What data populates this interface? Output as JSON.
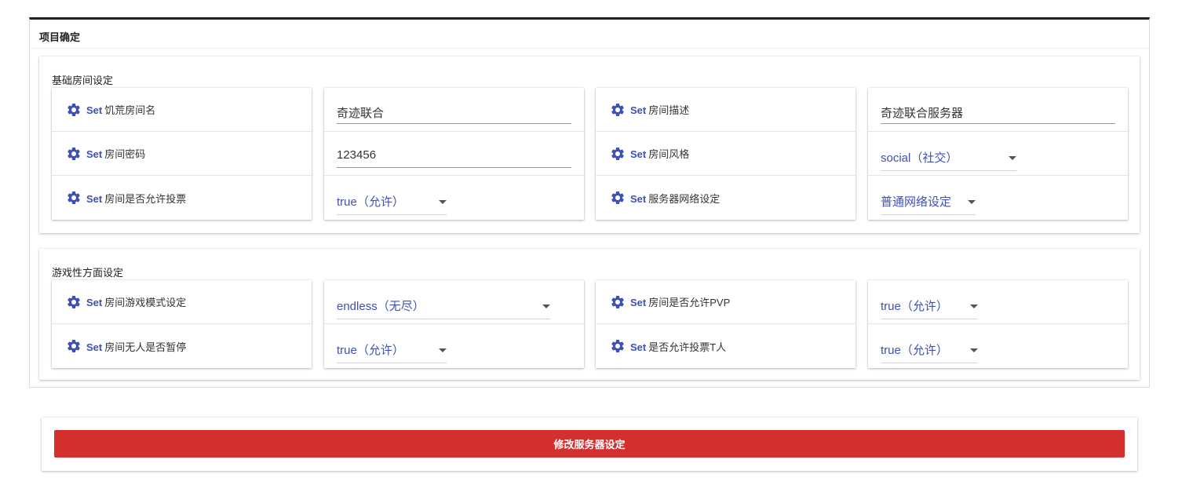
{
  "panel": {
    "title": "项目确定"
  },
  "basic": {
    "title": "基础房间设定",
    "set_prefix": "Set",
    "rows": [
      {
        "left_label": "饥荒房间名",
        "left_value": "奇迹联合",
        "right_label": "房间描述",
        "right_value": "奇迹联合服务器"
      },
      {
        "left_label": "房间密码",
        "left_value": "123456",
        "right_label": "房间风格",
        "right_value": "social（社交）"
      },
      {
        "left_label": "房间是否允许投票",
        "left_value": "true（允许）",
        "right_label": "服务器网络设定",
        "right_value": "普通网络设定"
      }
    ]
  },
  "game": {
    "title": "游戏性方面设定",
    "set_prefix": "Set",
    "rows": [
      {
        "left_label": "房间游戏模式设定",
        "left_value": "endless（无尽）",
        "right_label": "房间是否允许PVP",
        "right_value": "true（允许）"
      },
      {
        "left_label": "房间无人是否暂停",
        "left_value": "true（允许）",
        "right_label": "是否允许投票T人",
        "right_value": "true（允许）"
      }
    ]
  },
  "actions": {
    "submit_label": "修改服务器设定"
  },
  "icons": {
    "setting": "gear-icon",
    "dropdown": "caret-down-icon"
  },
  "colors": {
    "accent": "#3f51b5",
    "danger": "#d32f2f"
  }
}
